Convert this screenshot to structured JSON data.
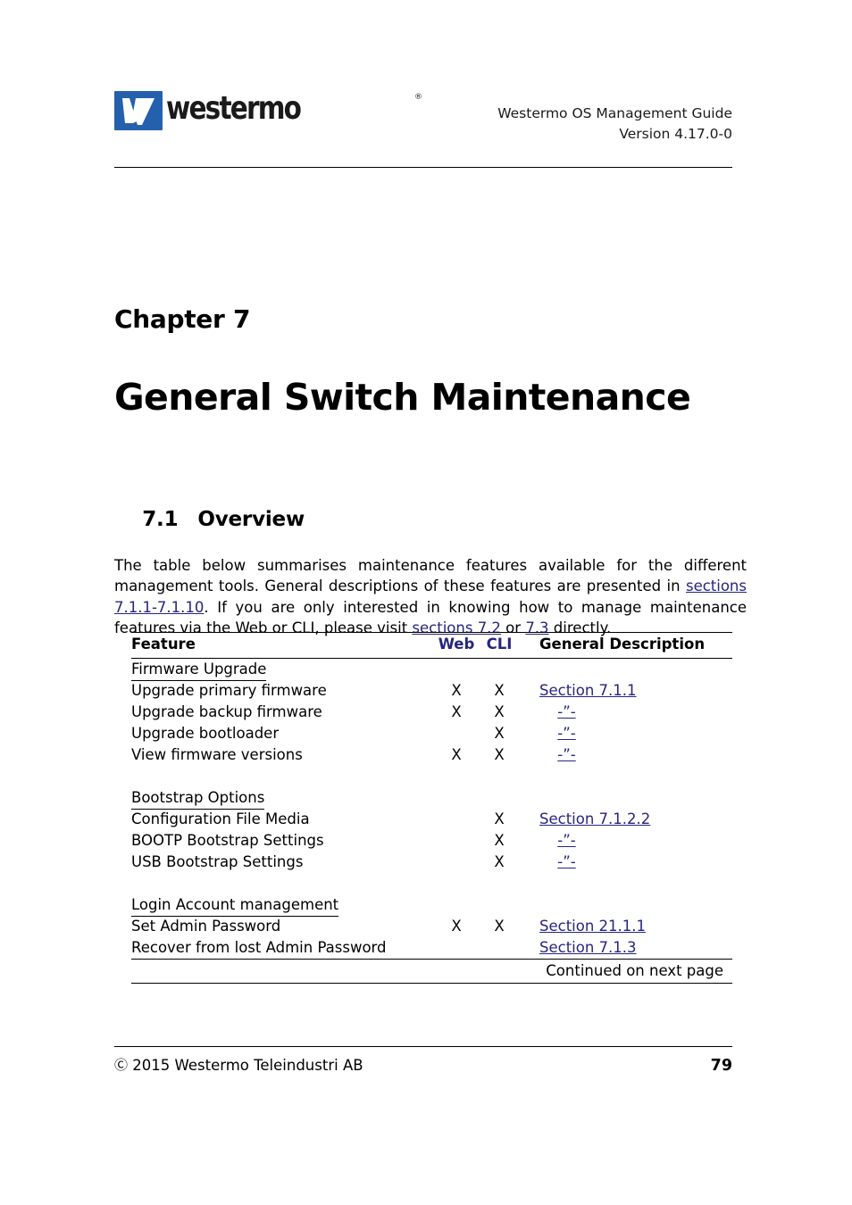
{
  "header": {
    "logo_wordmark": "westermo",
    "logo_registered": "®",
    "title_line1": "Westermo OS Management Guide",
    "title_line2": "Version 4.17.0-0"
  },
  "chapter": {
    "label": "Chapter 7",
    "title": "General Switch Maintenance"
  },
  "section": {
    "number": "7.1",
    "title": "Overview"
  },
  "intro": {
    "part1": "The table below summarises maintenance features available for the different management tools. General descriptions of these features are presented in ",
    "link1": "sections 7.1.1-7.1.10",
    "part2": ". If you are only interested in knowing how to manage maintenance features via the Web or CLI, please visit ",
    "link2": "sections 7.2",
    "part3": " or ",
    "link3": "7.3",
    "part4": " directly."
  },
  "table": {
    "headers": {
      "feature": "Feature",
      "web": "Web",
      "cli": "CLI",
      "description": "General Description"
    },
    "groups": [
      {
        "category": "Firmware Upgrade",
        "rows": [
          {
            "feature": "Upgrade primary firmware",
            "web": "X",
            "cli": "X",
            "description": "Section 7.1.1",
            "ditto": false
          },
          {
            "feature": "Upgrade backup firmware",
            "web": "X",
            "cli": "X",
            "description": "-”-",
            "ditto": true
          },
          {
            "feature": "Upgrade bootloader",
            "web": "",
            "cli": "X",
            "description": "-”-",
            "ditto": true
          },
          {
            "feature": "View firmware versions",
            "web": "X",
            "cli": "X",
            "description": "-”-",
            "ditto": true
          }
        ]
      },
      {
        "category": "Bootstrap Options",
        "rows": [
          {
            "feature": "Configuration File Media",
            "web": "",
            "cli": "X",
            "description": "Section 7.1.2.2",
            "ditto": false
          },
          {
            "feature": "BOOTP Bootstrap Settings",
            "web": "",
            "cli": "X",
            "description": "-”-",
            "ditto": true
          },
          {
            "feature": "USB Bootstrap Settings",
            "web": "",
            "cli": "X",
            "description": "-”-",
            "ditto": true
          }
        ]
      },
      {
        "category": "Login Account management",
        "rows": [
          {
            "feature": "Set Admin Password",
            "web": "X",
            "cli": "X",
            "description": "Section 21.1.1",
            "ditto": false
          },
          {
            "feature": "Recover from lost Admin Password",
            "web": "",
            "cli": "",
            "description": "Section 7.1.3",
            "ditto": false
          }
        ]
      }
    ],
    "continued": "Continued on next page"
  },
  "footer": {
    "copyright": "2015 Westermo Teleindustri AB",
    "copyright_symbol": "Ⓒ",
    "page_number": "79"
  },
  "colors": {
    "link": "#252580",
    "logo_blue": "#2560ad",
    "text": "#000000"
  }
}
